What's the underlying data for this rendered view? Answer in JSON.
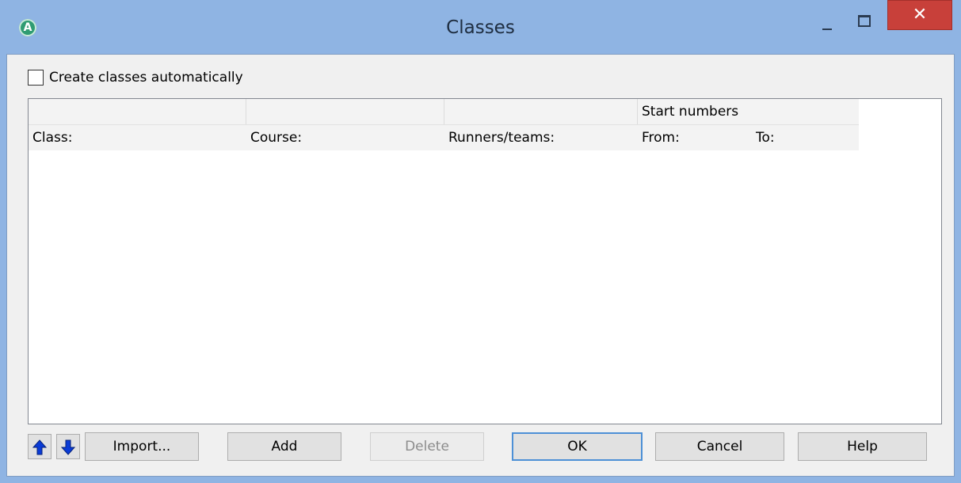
{
  "window": {
    "title": "Classes",
    "app_icon_letter": "A",
    "close_glyph": "✕"
  },
  "options": {
    "create_auto_label": "Create classes automatically",
    "create_auto_checked": false
  },
  "table": {
    "group_header": "Start numbers",
    "columns": [
      "Class:",
      "Course:",
      "Runners/teams:",
      "From:",
      "To:"
    ],
    "rows": []
  },
  "buttons": {
    "move_up_icon": "arrow-up-icon",
    "move_down_icon": "arrow-down-icon",
    "import_label": "Import...",
    "add_label": "Add",
    "delete_label": "Delete",
    "ok_label": "OK",
    "cancel_label": "Cancel",
    "help_label": "Help"
  },
  "colors": {
    "titlebar": "#8fb4e3",
    "close": "#c8403a",
    "arrow": "#0a3bd6"
  }
}
